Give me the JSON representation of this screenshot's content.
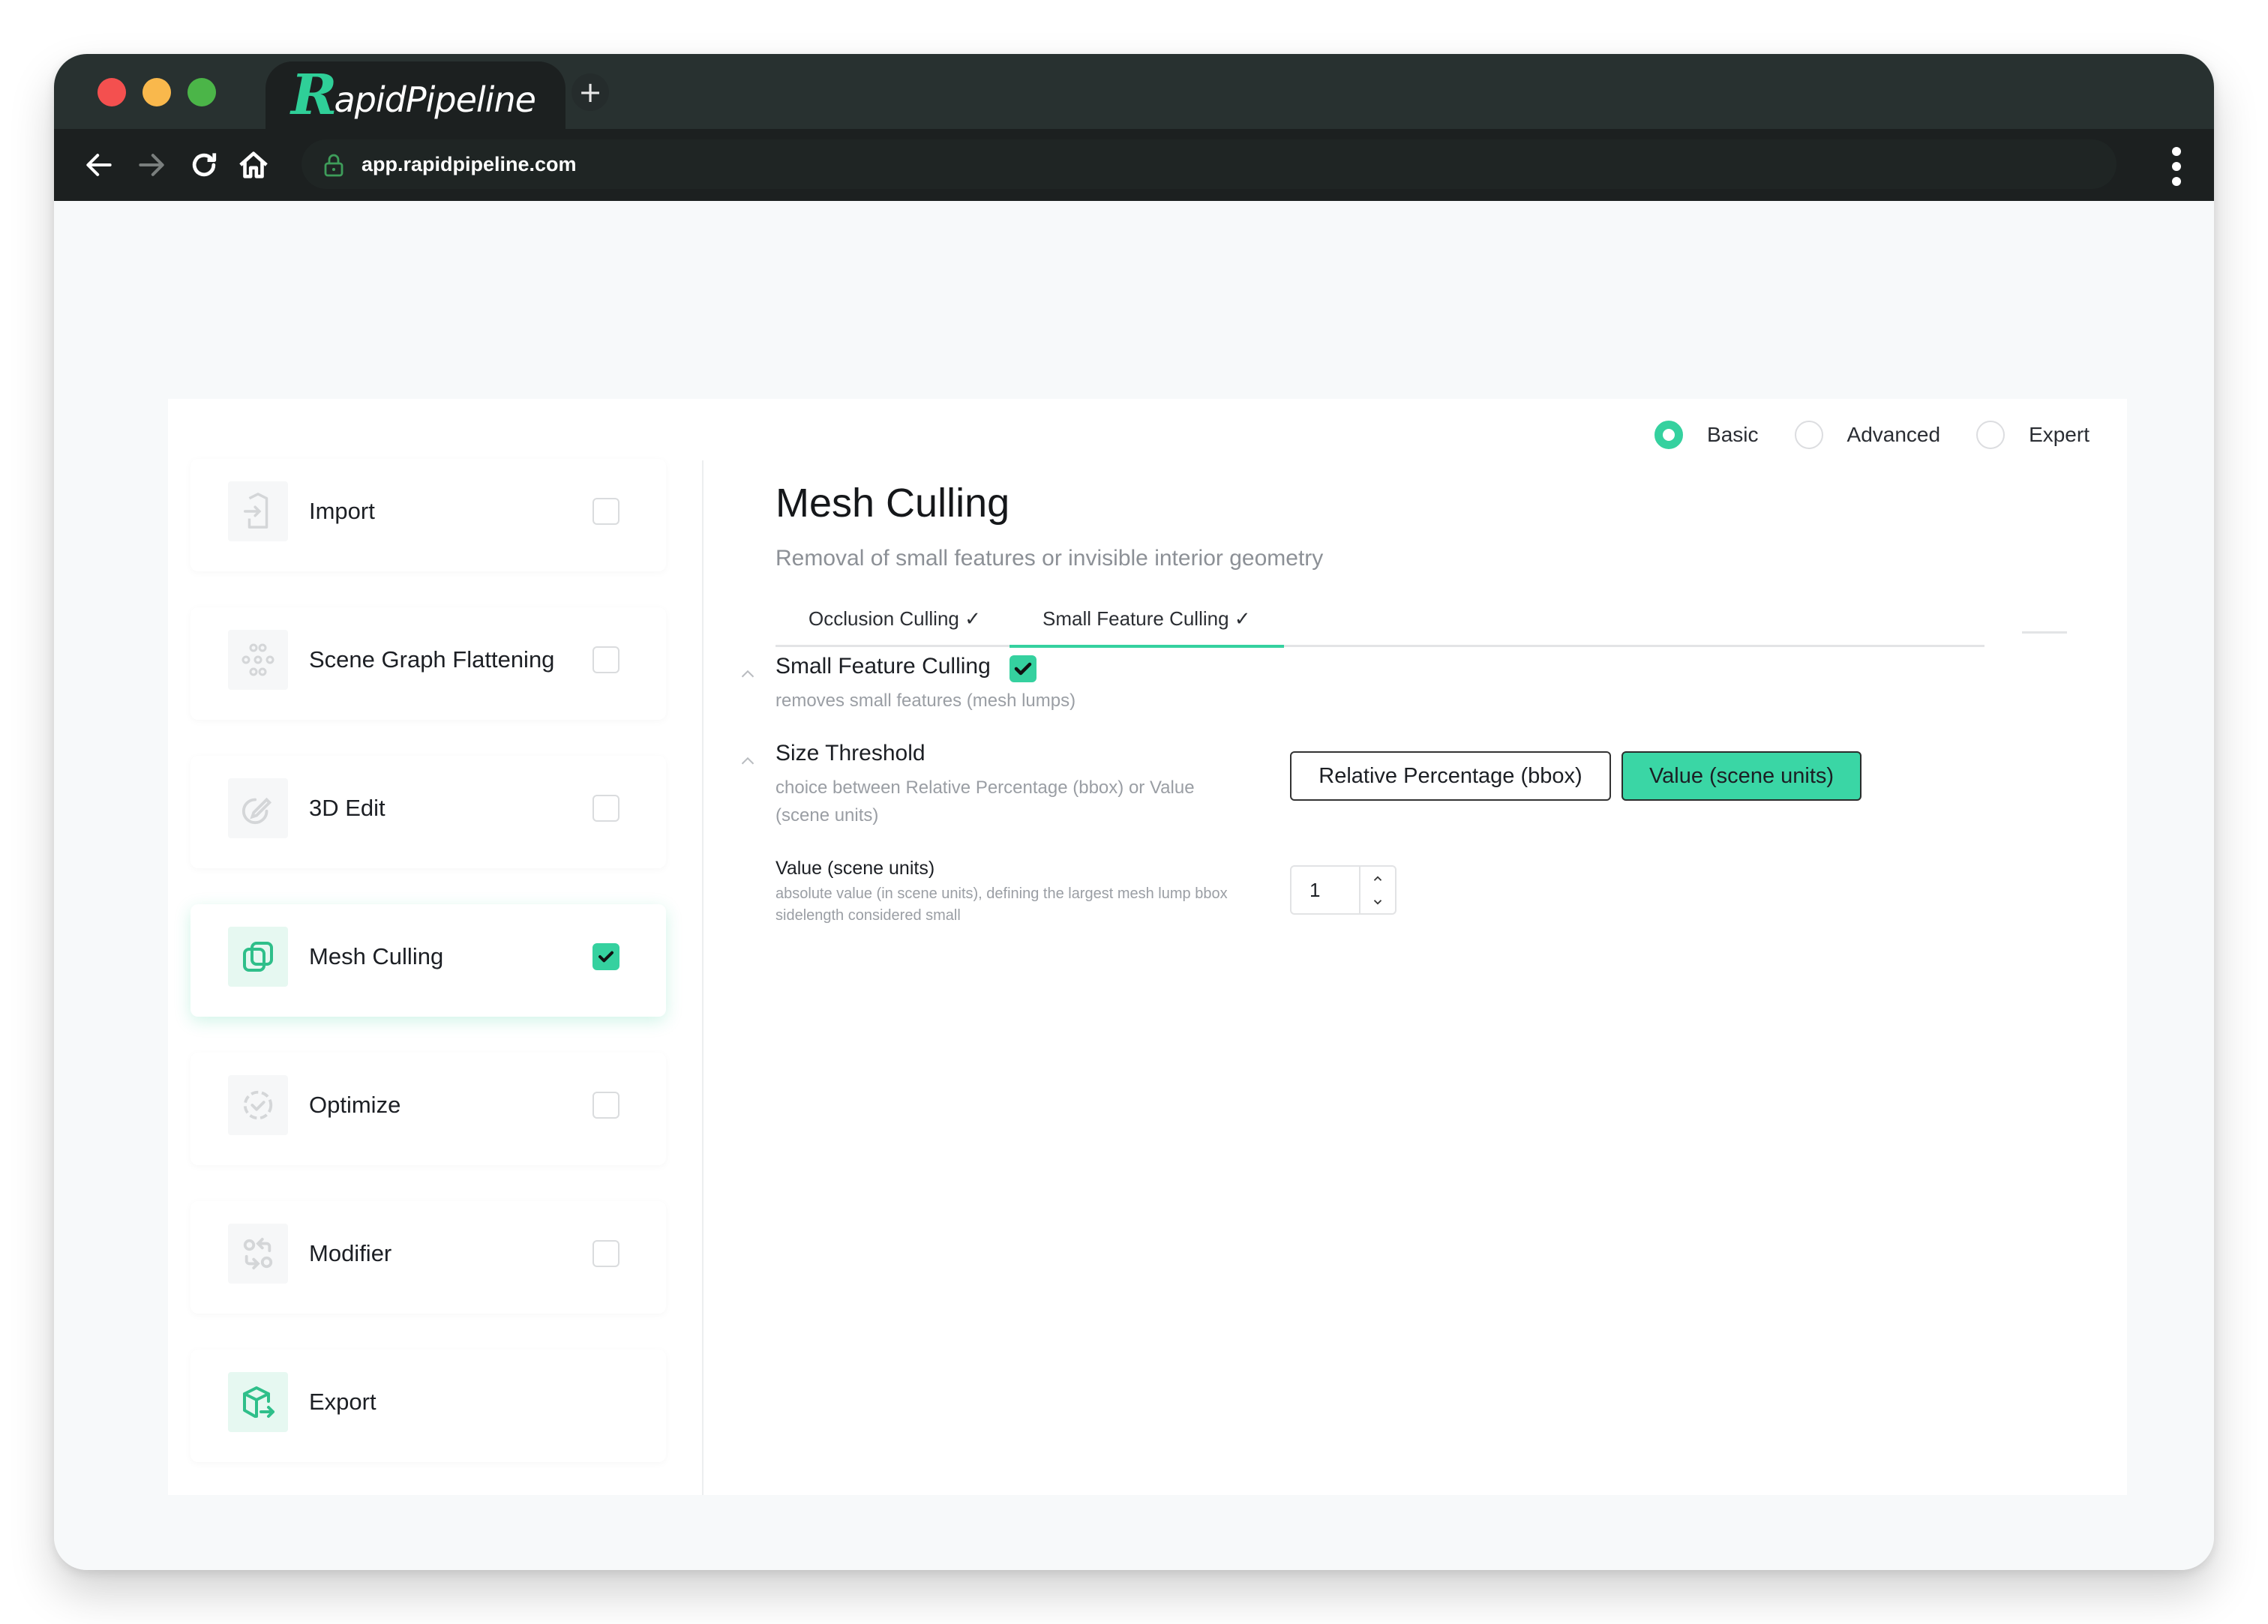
{
  "browser": {
    "tab_title_logo_initial": "R",
    "tab_title_logo_rest": "apidPipeline",
    "new_tab_label": "+",
    "url": "app.rapidpipeline.com",
    "icons": {
      "back": "arrow-left-icon",
      "forward": "arrow-right-icon",
      "reload": "reload-icon",
      "home": "home-icon",
      "lock": "lock-icon",
      "menu": "kebab-menu-icon"
    }
  },
  "colors": {
    "accent": "#35d19f",
    "tabbar": "#283130",
    "navbar": "#1c2020"
  },
  "modes": {
    "options": [
      {
        "label": "Basic",
        "selected": true
      },
      {
        "label": "Advanced",
        "selected": false
      },
      {
        "label": "Expert",
        "selected": false
      }
    ]
  },
  "sidebar": {
    "items": [
      {
        "label": "Import",
        "icon": "import-icon",
        "checked": false,
        "active": false
      },
      {
        "label": "Scene Graph Flattening",
        "icon": "scene-graph-icon",
        "checked": false,
        "active": false
      },
      {
        "label": "3D Edit",
        "icon": "edit-icon",
        "checked": false,
        "active": false
      },
      {
        "label": "Mesh Culling",
        "icon": "layers-icon",
        "checked": true,
        "active": true
      },
      {
        "label": "Optimize",
        "icon": "optimize-icon",
        "checked": false,
        "active": false
      },
      {
        "label": "Modifier",
        "icon": "modifier-icon",
        "checked": false,
        "active": false
      },
      {
        "label": "Export",
        "icon": "export-box-icon",
        "checked": null,
        "active": false
      }
    ]
  },
  "main": {
    "title": "Mesh Culling",
    "subtitle": "Removal of small features or invisible interior geometry",
    "tabs": [
      {
        "label": "Occlusion Culling ✓",
        "active": false
      },
      {
        "label": "Small Feature Culling ✓",
        "active": true
      }
    ],
    "small_feature_culling": {
      "title": "Small Feature Culling",
      "checked": true,
      "description": "removes small features (mesh lumps)"
    },
    "size_threshold": {
      "title": "Size Threshold",
      "description": "choice between Relative Percentage (bbox) or Value (scene units)",
      "options": [
        {
          "label": "Relative Percentage (bbox)",
          "selected": false
        },
        {
          "label": "Value (scene units)",
          "selected": true
        }
      ]
    },
    "value_scene_units": {
      "title": "Value (scene units)",
      "description": "absolute value (in scene units), defining the largest mesh lump bbox sidelength considered small",
      "value": "1"
    }
  }
}
